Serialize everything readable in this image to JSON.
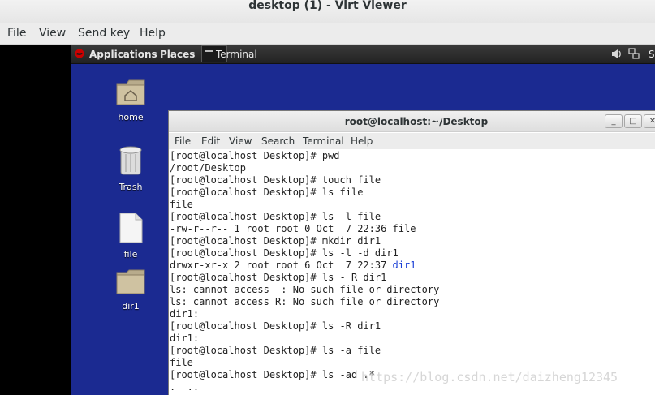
{
  "viewer": {
    "title": "desktop (1) - Virt Viewer",
    "menu": [
      "File",
      "View",
      "Send key",
      "Help"
    ]
  },
  "guest_panel": {
    "applications": "Applications",
    "places": "Places",
    "task": "Terminal",
    "right_partial": "S"
  },
  "desktop_icons": [
    {
      "label": "home"
    },
    {
      "label": "Trash"
    },
    {
      "label": "file"
    },
    {
      "label": "dir1"
    }
  ],
  "terminal": {
    "title": "root@localhost:~/Desktop",
    "menu": [
      "File",
      "Edit",
      "View",
      "Search",
      "Terminal",
      "Help"
    ],
    "lines": [
      "[root@localhost Desktop]# pwd",
      "/root/Desktop",
      "[root@localhost Desktop]# touch file",
      "[root@localhost Desktop]# ls file",
      "file",
      "[root@localhost Desktop]# ls -l file",
      "-rw-r--r-- 1 root root 0 Oct  7 22:36 file",
      "[root@localhost Desktop]# mkdir dir1",
      "[root@localhost Desktop]# ls -l -d dir1",
      "drwxr-xr-x 2 root root 6 Oct  7 22:37 ",
      "[root@localhost Desktop]# ls - R dir1",
      "ls: cannot access -: No such file or directory",
      "ls: cannot access R: No such file or directory",
      "dir1:",
      "[root@localhost Desktop]# ls -R dir1",
      "dir1:",
      "[root@localhost Desktop]# ls -a file",
      "file",
      "[root@localhost Desktop]# ls -ad .*",
      ".  .."
    ],
    "line9_dir": "dir1"
  },
  "watermark": "https://blog.csdn.net/daizheng12345",
  "colors": {
    "desktop_bg": "#1b2a91",
    "dir_highlight": "#1a3fd6"
  }
}
